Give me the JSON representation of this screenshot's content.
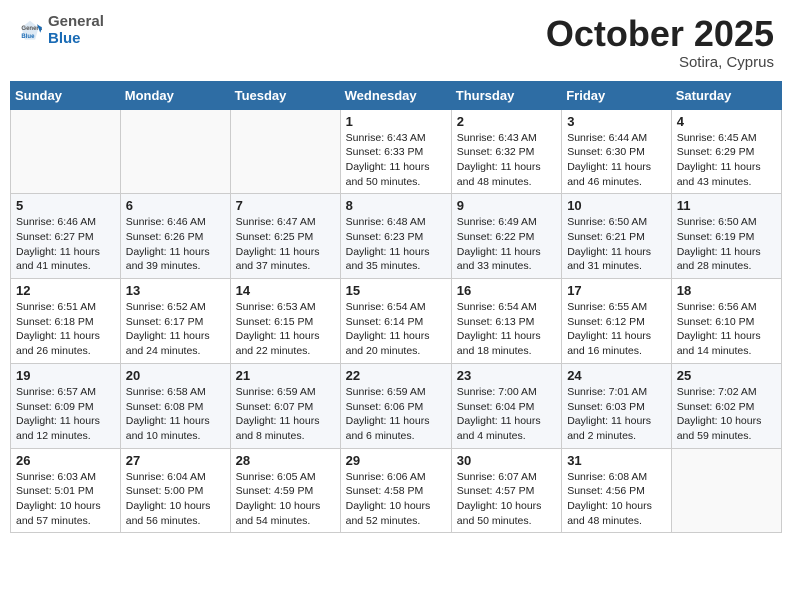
{
  "header": {
    "logo_general": "General",
    "logo_blue": "Blue",
    "month_title": "October 2025",
    "subtitle": "Sotira, Cyprus"
  },
  "days_of_week": [
    "Sunday",
    "Monday",
    "Tuesday",
    "Wednesday",
    "Thursday",
    "Friday",
    "Saturday"
  ],
  "weeks": [
    [
      {
        "day": "",
        "info": ""
      },
      {
        "day": "",
        "info": ""
      },
      {
        "day": "",
        "info": ""
      },
      {
        "day": "1",
        "info": "Sunrise: 6:43 AM\nSunset: 6:33 PM\nDaylight: 11 hours\nand 50 minutes."
      },
      {
        "day": "2",
        "info": "Sunrise: 6:43 AM\nSunset: 6:32 PM\nDaylight: 11 hours\nand 48 minutes."
      },
      {
        "day": "3",
        "info": "Sunrise: 6:44 AM\nSunset: 6:30 PM\nDaylight: 11 hours\nand 46 minutes."
      },
      {
        "day": "4",
        "info": "Sunrise: 6:45 AM\nSunset: 6:29 PM\nDaylight: 11 hours\nand 43 minutes."
      }
    ],
    [
      {
        "day": "5",
        "info": "Sunrise: 6:46 AM\nSunset: 6:27 PM\nDaylight: 11 hours\nand 41 minutes."
      },
      {
        "day": "6",
        "info": "Sunrise: 6:46 AM\nSunset: 6:26 PM\nDaylight: 11 hours\nand 39 minutes."
      },
      {
        "day": "7",
        "info": "Sunrise: 6:47 AM\nSunset: 6:25 PM\nDaylight: 11 hours\nand 37 minutes."
      },
      {
        "day": "8",
        "info": "Sunrise: 6:48 AM\nSunset: 6:23 PM\nDaylight: 11 hours\nand 35 minutes."
      },
      {
        "day": "9",
        "info": "Sunrise: 6:49 AM\nSunset: 6:22 PM\nDaylight: 11 hours\nand 33 minutes."
      },
      {
        "day": "10",
        "info": "Sunrise: 6:50 AM\nSunset: 6:21 PM\nDaylight: 11 hours\nand 31 minutes."
      },
      {
        "day": "11",
        "info": "Sunrise: 6:50 AM\nSunset: 6:19 PM\nDaylight: 11 hours\nand 28 minutes."
      }
    ],
    [
      {
        "day": "12",
        "info": "Sunrise: 6:51 AM\nSunset: 6:18 PM\nDaylight: 11 hours\nand 26 minutes."
      },
      {
        "day": "13",
        "info": "Sunrise: 6:52 AM\nSunset: 6:17 PM\nDaylight: 11 hours\nand 24 minutes."
      },
      {
        "day": "14",
        "info": "Sunrise: 6:53 AM\nSunset: 6:15 PM\nDaylight: 11 hours\nand 22 minutes."
      },
      {
        "day": "15",
        "info": "Sunrise: 6:54 AM\nSunset: 6:14 PM\nDaylight: 11 hours\nand 20 minutes."
      },
      {
        "day": "16",
        "info": "Sunrise: 6:54 AM\nSunset: 6:13 PM\nDaylight: 11 hours\nand 18 minutes."
      },
      {
        "day": "17",
        "info": "Sunrise: 6:55 AM\nSunset: 6:12 PM\nDaylight: 11 hours\nand 16 minutes."
      },
      {
        "day": "18",
        "info": "Sunrise: 6:56 AM\nSunset: 6:10 PM\nDaylight: 11 hours\nand 14 minutes."
      }
    ],
    [
      {
        "day": "19",
        "info": "Sunrise: 6:57 AM\nSunset: 6:09 PM\nDaylight: 11 hours\nand 12 minutes."
      },
      {
        "day": "20",
        "info": "Sunrise: 6:58 AM\nSunset: 6:08 PM\nDaylight: 11 hours\nand 10 minutes."
      },
      {
        "day": "21",
        "info": "Sunrise: 6:59 AM\nSunset: 6:07 PM\nDaylight: 11 hours\nand 8 minutes."
      },
      {
        "day": "22",
        "info": "Sunrise: 6:59 AM\nSunset: 6:06 PM\nDaylight: 11 hours\nand 6 minutes."
      },
      {
        "day": "23",
        "info": "Sunrise: 7:00 AM\nSunset: 6:04 PM\nDaylight: 11 hours\nand 4 minutes."
      },
      {
        "day": "24",
        "info": "Sunrise: 7:01 AM\nSunset: 6:03 PM\nDaylight: 11 hours\nand 2 minutes."
      },
      {
        "day": "25",
        "info": "Sunrise: 7:02 AM\nSunset: 6:02 PM\nDaylight: 10 hours\nand 59 minutes."
      }
    ],
    [
      {
        "day": "26",
        "info": "Sunrise: 6:03 AM\nSunset: 5:01 PM\nDaylight: 10 hours\nand 57 minutes."
      },
      {
        "day": "27",
        "info": "Sunrise: 6:04 AM\nSunset: 5:00 PM\nDaylight: 10 hours\nand 56 minutes."
      },
      {
        "day": "28",
        "info": "Sunrise: 6:05 AM\nSunset: 4:59 PM\nDaylight: 10 hours\nand 54 minutes."
      },
      {
        "day": "29",
        "info": "Sunrise: 6:06 AM\nSunset: 4:58 PM\nDaylight: 10 hours\nand 52 minutes."
      },
      {
        "day": "30",
        "info": "Sunrise: 6:07 AM\nSunset: 4:57 PM\nDaylight: 10 hours\nand 50 minutes."
      },
      {
        "day": "31",
        "info": "Sunrise: 6:08 AM\nSunset: 4:56 PM\nDaylight: 10 hours\nand 48 minutes."
      },
      {
        "day": "",
        "info": ""
      }
    ]
  ]
}
